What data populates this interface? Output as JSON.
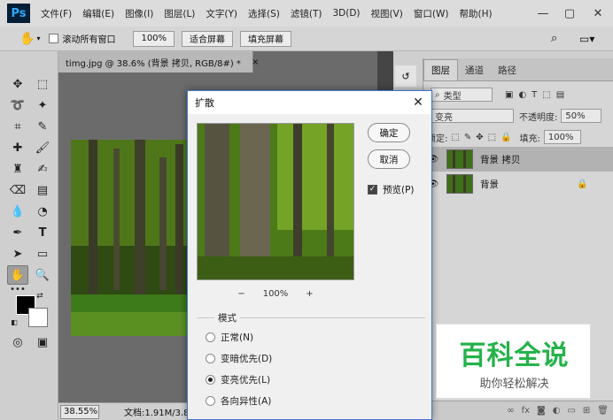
{
  "app": {
    "logo": "Ps"
  },
  "menu": [
    "文件(F)",
    "编辑(E)",
    "图像(I)",
    "图层(L)",
    "文字(Y)",
    "选择(S)",
    "滤镜(T)",
    "3D(D)",
    "视图(V)",
    "窗口(W)",
    "帮助(H)"
  ],
  "window_controls": {
    "minimize": "—",
    "maximize": "▢",
    "close": "✕"
  },
  "options": {
    "scroll_all": "滚动所有窗口",
    "zoom_100": "100%",
    "fit_screen": "适合屏幕",
    "fill_screen": "填充屏幕"
  },
  "document": {
    "tab_title": "timg.jpg @ 38.6% (背景 拷贝, RGB/8#) *",
    "tab_close": "×",
    "zoom": "38.55%",
    "doc_info": "文档:1.91M/3.8"
  },
  "layers_panel": {
    "tabs": [
      "图层",
      "通道",
      "路径"
    ],
    "kind_label": "类型",
    "blend_mode": "变亮",
    "opacity_label": "不透明度:",
    "opacity_value": "50%",
    "lock_label": "锁定:",
    "fill_label": "填充:",
    "fill_value": "100%",
    "layers": [
      {
        "name": "背景 拷贝",
        "selected": true
      },
      {
        "name": "背景",
        "selected": false,
        "locked": true
      }
    ],
    "footer_icons": [
      "link-icon",
      "fx-icon",
      "mask-icon",
      "adjustment-icon",
      "folder-icon",
      "new-layer-icon",
      "trash-icon"
    ]
  },
  "dialog": {
    "title": "扩散",
    "close": "✕",
    "ok": "确定",
    "cancel": "取消",
    "preview_label": "预览(P)",
    "preview_checked": true,
    "zoom_level": "100%",
    "zoom_out": "−",
    "zoom_in": "+",
    "mode_label": "模式",
    "modes": [
      {
        "label": "正常(N)",
        "selected": false
      },
      {
        "label": "变暗优先(D)",
        "selected": false
      },
      {
        "label": "变亮优先(L)",
        "selected": true
      },
      {
        "label": "各向异性(A)",
        "selected": false
      }
    ]
  },
  "watermark": {
    "title": "百科全说",
    "subtitle": "助你轻松解决"
  },
  "colors": {
    "accent": "#3c78c8",
    "watermark_green": "#25b24a",
    "foreground": "#000000",
    "background": "#ffffff"
  }
}
